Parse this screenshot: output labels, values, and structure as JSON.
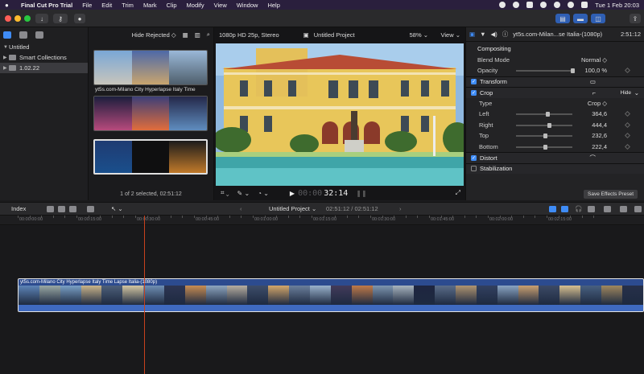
{
  "menubar": {
    "app_name": "Final Cut Pro Trial",
    "items": [
      "File",
      "Edit",
      "Trim",
      "Mark",
      "Clip",
      "Modify",
      "View",
      "Window",
      "Help"
    ],
    "clock": "Tue 1 Feb  20:03"
  },
  "libraries": {
    "items": [
      {
        "label": "Untitled",
        "icon": "library-icon",
        "expanded": true
      },
      {
        "label": "Smart Collections",
        "icon": "folder-icon",
        "expanded": false
      },
      {
        "label": "1.02.22",
        "icon": "event-icon",
        "expanded": false,
        "selected": true
      }
    ]
  },
  "browser": {
    "filter": "Hide Rejected ◇",
    "clip_caption": "yt5s.com-Milano City Hyperlapse Italy Time",
    "footer": "1 of 2 selected, 02:51:12"
  },
  "viewer": {
    "format": "1080p HD 25p, Stereo",
    "project": "Untitled Project",
    "zoom": "58% ⌄",
    "view": "View ⌄",
    "timecode_dim": "00:00",
    "timecode": "32:14"
  },
  "inspector": {
    "clip_name": "yt5s.com-Milan...se Italia-(1080p)",
    "duration": "2:51:12",
    "compositing_label": "Compositing",
    "blend_mode_label": "Blend Mode",
    "blend_mode_value": "Normal ◇",
    "opacity_label": "Opacity",
    "opacity_value": "100,0 %",
    "opacity_fraction": 1.0,
    "transform_label": "Transform",
    "crop_label": "Crop",
    "hide_label": "Hide",
    "type_label": "Type",
    "type_value": "Crop ◇",
    "crop_fields": [
      {
        "label": "Left",
        "value": "364,6",
        "fraction": 0.55
      },
      {
        "label": "Right",
        "value": "444,4",
        "fraction": 0.58
      },
      {
        "label": "Top",
        "value": "232,6",
        "fraction": 0.52
      },
      {
        "label": "Bottom",
        "value": "222,4",
        "fraction": 0.52
      }
    ],
    "distort_label": "Distort",
    "stabilization_label": "Stabilization",
    "save_preset": "Save Effects Preset"
  },
  "timeline": {
    "index_label": "Index",
    "project": "Untitled Project ⌄",
    "position": "02:51:12 / 02:51:12",
    "ruler": [
      "00:00:00:00",
      "00:00:15:00",
      "00:00:30:00",
      "00:00:45:00",
      "00:01:00:00",
      "00:01:15:00",
      "00:01:30:00",
      "00:01:45:00",
      "00:02:00:00",
      "00:02:15:00"
    ],
    "clip_title": "yt5s.com-Milano City Hyperlapse Italy Time Lapse Italia-(1080p)"
  },
  "colors": {
    "accent": "#3f8cf6",
    "playhead": "#c8421e",
    "clip": "#2c4b8f"
  }
}
